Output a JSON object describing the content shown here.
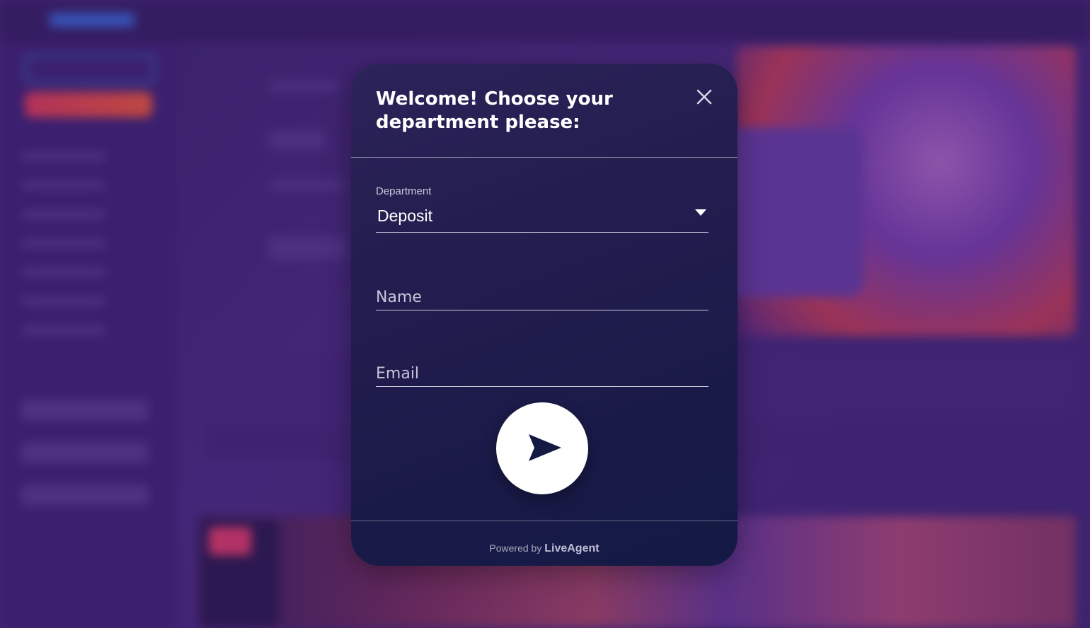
{
  "widget": {
    "title": "Welcome! Choose your department please:",
    "department": {
      "label": "Department",
      "selected": "Deposit"
    },
    "name_field": {
      "placeholder": "Name",
      "value": ""
    },
    "email_field": {
      "placeholder": "Email",
      "value": ""
    },
    "send_icon": "send-icon",
    "close_icon": "close-icon",
    "footer": {
      "powered_by": "Powered by",
      "brand": "LiveAgent"
    }
  },
  "colors": {
    "widget_bg": "#221d4e",
    "background": "#4a2a7a",
    "send_button": "#ffffff",
    "send_arrow": "#151a44"
  }
}
